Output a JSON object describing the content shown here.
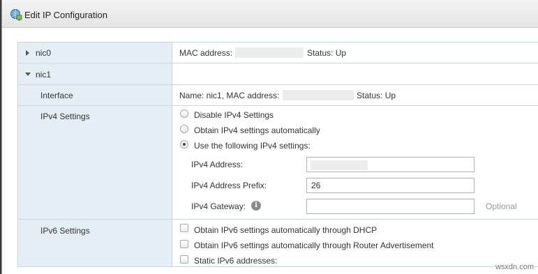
{
  "dialog": {
    "title": "Edit IP Configuration",
    "title_icon": "network-globe-icon"
  },
  "rows": {
    "nic0": {
      "label": "nic0",
      "mac_label": "MAC address:",
      "status": "Status: Up"
    },
    "nic1": {
      "label": "nic1"
    },
    "interface": {
      "label": "Interface",
      "name_text": "Name: nic1, MAC address:",
      "status": "Status: Up"
    },
    "ipv4": {
      "label": "IPv4 Settings",
      "options": [
        {
          "label": "Disable IPv4 Settings",
          "selected": false
        },
        {
          "label": "Obtain IPv4 settings automatically",
          "selected": false
        },
        {
          "label": "Use the following IPv4 settings:",
          "selected": true
        }
      ],
      "address_label": "IPv4 Address:",
      "address_value": "",
      "prefix_label": "IPv4 Address Prefix:",
      "prefix_value": "26",
      "gateway_label": "IPv4 Gateway:",
      "gateway_value": "",
      "gateway_placeholder": "Optional",
      "info_icon": "info-icon"
    },
    "ipv6": {
      "label": "IPv6 Settings",
      "options": [
        {
          "label": "Obtain IPv6 settings automatically through DHCP",
          "checked": false
        },
        {
          "label": "Obtain IPv6 settings automatically through Router Advertisement",
          "checked": false
        },
        {
          "label": "Static IPv6 addresses:",
          "checked": false
        }
      ]
    }
  },
  "watermark": "wsxdn.com",
  "colors": {
    "left_column_bg": "#e3eef5",
    "grid_line": "#c9d6e0"
  }
}
